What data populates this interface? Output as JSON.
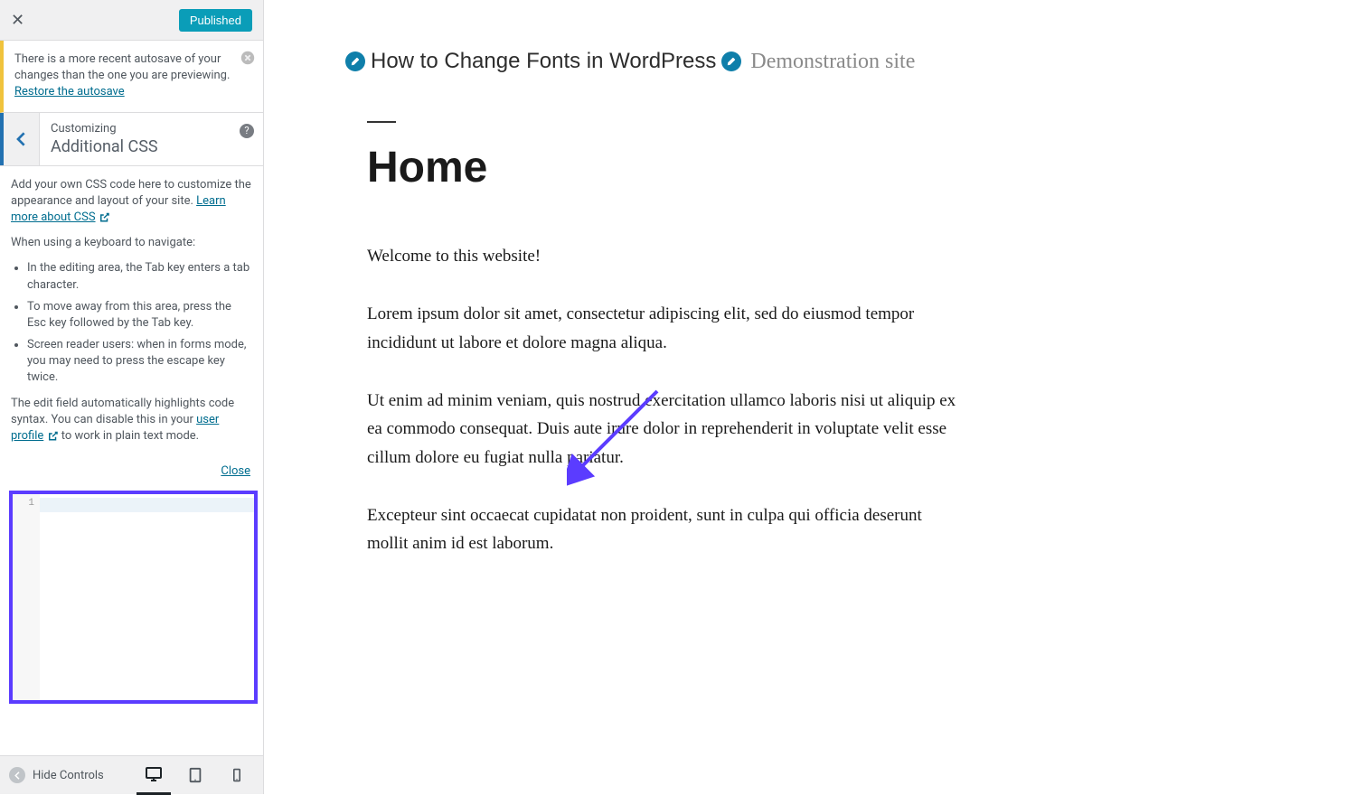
{
  "topbar": {
    "published": "Published"
  },
  "notice": {
    "text": "There is a more recent autosave of your changes than the one you are previewing. ",
    "link": "Restore the autosave"
  },
  "section": {
    "sup": "Customizing",
    "main": "Additional CSS"
  },
  "desc": {
    "intro": "Add your own CSS code here to customize the appearance and layout of your site.",
    "learn_more": "Learn more about CSS",
    "keyboard": "When using a keyboard to navigate:",
    "li1": "In the editing area, the Tab key enters a tab character.",
    "li2": "To move away from this area, press the Esc key followed by the Tab key.",
    "li3": "Screen reader users: when in forms mode, you may need to press the escape key twice.",
    "syntax1": "The edit field automatically highlights code syntax. You can disable this in your ",
    "user_profile": "user profile",
    "syntax2": " to work in plain text mode.",
    "close": "Close"
  },
  "editor": {
    "line1": "1"
  },
  "footer": {
    "hide": "Hide Controls"
  },
  "preview": {
    "site_title": "How to Change Fonts in WordPress",
    "site_tag": "Demonstration site",
    "page_title": "Home",
    "p1": "Welcome to this website!",
    "p2": "Lorem ipsum dolor sit amet, consectetur adipiscing elit, sed do eiusmod tempor incididunt ut labore et dolore magna aliqua.",
    "p3": "Ut enim ad minim veniam, quis nostrud exercitation ullamco laboris nisi ut aliquip ex ea commodo consequat. Duis aute irure dolor in reprehenderit in voluptate velit esse cillum dolore eu fugiat nulla pariatur.",
    "p4": "Excepteur sint occaecat cupidatat non proident, sunt in culpa qui officia deserunt mollit anim id est laborum."
  }
}
